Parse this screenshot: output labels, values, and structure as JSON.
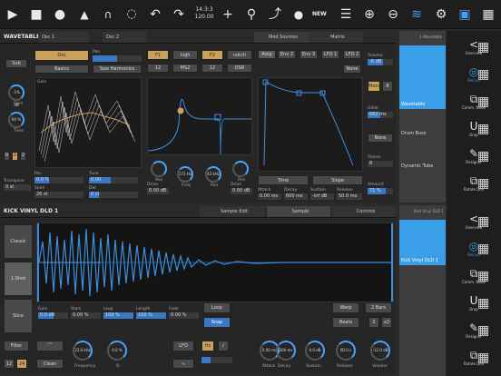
{
  "toolbar": {
    "time_top": "14:3:3",
    "time_bottom": "120.00",
    "new_label": "NEW"
  },
  "device1": {
    "title": "WAVETABLE",
    "tabs": [
      "Osc 1",
      "Osc 2",
      "Mod Sources",
      "Matrix"
    ],
    "chain_label": "1-Wavetable",
    "sub_label": "Sub",
    "osc_btn": "Osc",
    "basics_btn": "Basics",
    "harmonics_btn": "Saw Harmonics",
    "pan_label": "Pan",
    "filter1": "F1",
    "filter1_type": "high",
    "filter2": "F2",
    "filter2_type": "notch",
    "f1_slope": "12",
    "f1_circuit": "MS2",
    "f2_slope": "12",
    "f2_circuit": "OSR",
    "env_tabs": [
      "Amp",
      "Env 2",
      "Env 3",
      "LFO 1",
      "LFO 2"
    ],
    "none_label": "None",
    "knobs": [
      {
        "label": "Gain",
        "value": "-1% dB"
      },
      {
        "label": "Time",
        "value": "60 %"
      },
      {
        "label": "Res",
        "value": ""
      },
      {
        "label": "Freq",
        "value": "172 Hz"
      },
      {
        "label": "Res",
        "value": "43 kHz"
      },
      {
        "label": "Res",
        "value": ""
      }
    ],
    "voice_btns": [
      "0",
      "2",
      "2"
    ],
    "transpose": {
      "label": "Transpose",
      "value": "0 st"
    },
    "pos": {
      "label": "Pos",
      "value": "0.0 %"
    },
    "tune": {
      "label": "Tune",
      "value": "0.00"
    },
    "semi": {
      "label": "Semi",
      "value": "26 st"
    },
    "det": {
      "label": "Det",
      "value": "0 ct"
    },
    "drive1": {
      "label": "Drive",
      "value": "0.00 dB"
    },
    "drive2": {
      "label": "Drive",
      "value": "0.00 dB"
    },
    "time_btn": "Time",
    "slope_btn": "Slope",
    "adsr": [
      {
        "label": "Attack",
        "value": "0.00 ms"
      },
      {
        "label": "Decay",
        "value": "600 ms"
      },
      {
        "label": "Sustain",
        "value": "-inf dB"
      },
      {
        "label": "Release",
        "value": "50.0 ms"
      }
    ],
    "volume": {
      "label": "Volume",
      "value": "-6 dB"
    },
    "mono_label": "Mono",
    "mono_value": "8",
    "glide": {
      "label": "Glide",
      "value": "662 ms"
    },
    "none2": "None",
    "voices": {
      "label": "Voices",
      "value": "8"
    },
    "amount": {
      "label": "Amount",
      "value": "71 %"
    }
  },
  "rack1": {
    "items": [
      "Wavetable",
      "Drum Buss",
      "Dynamic Tube"
    ]
  },
  "device2": {
    "title": "KICK VINYL DLD 1",
    "tabs": [
      "Sample Edit",
      "Sample",
      "Controls"
    ],
    "chain_label": "Kick Vinyl DLD 1",
    "modes": [
      "Classic",
      "1-Shot",
      "Slice"
    ],
    "params": [
      {
        "label": "Gain",
        "value": "0.0 dB"
      },
      {
        "label": "Start",
        "value": "0.00 %"
      },
      {
        "label": "Loop",
        "value": "100 %"
      },
      {
        "label": "Length",
        "value": "100 %"
      },
      {
        "label": "Fade",
        "value": "0.00 %"
      }
    ],
    "loop_btn": "Loop",
    "snap_btn": "Snap",
    "warp_btn": "Warp",
    "bars_btn": "2 Bars",
    "beats_label": "Beats",
    "x2": "x2",
    "div2": "2",
    "filter_btn": "Filter",
    "mode12": "12",
    "mode24": "24",
    "clean": "Clean",
    "freq": {
      "label": "Frequency",
      "value": "22.0 kHz"
    },
    "q": {
      "label": "Q",
      "value": "0.0 %"
    },
    "lfo": "LFO",
    "hz": "Hz",
    "bottom_knobs": [
      {
        "label": "Attack",
        "value": "0.00 ms"
      },
      {
        "label": "Decay",
        "value": "300 ms"
      },
      {
        "label": "Sustain",
        "value": "0.0 dB"
      },
      {
        "label": "Release",
        "value": "60.0 s"
      },
      {
        "label": "Volume",
        "value": "-12.0 dB"
      }
    ]
  },
  "rack2": {
    "items": [
      "Kick Vinyl DLD 1"
    ]
  },
  "icons": [
    {
      "label": "Overview",
      "icon": "<"
    },
    {
      "label": "Record",
      "icon": "◎"
    },
    {
      "label": "Comm. Node",
      "icon": "⧉"
    },
    {
      "label": "Drop",
      "icon": "U"
    },
    {
      "label": "Designer",
      "icon": "✎"
    },
    {
      "label": "Rotate Dev",
      "icon": "⧉"
    },
    {
      "label": "Overview",
      "icon": "<"
    },
    {
      "label": "Record",
      "icon": "◎"
    },
    {
      "label": "Comm. Node",
      "icon": "⧉"
    },
    {
      "label": "Drop",
      "icon": "U"
    },
    {
      "label": "Designer",
      "icon": "✎"
    },
    {
      "label": "Rotate Dev",
      "icon": "⧉"
    }
  ],
  "colors": {
    "accent": "#3a78c4",
    "gold": "#c9a15b",
    "wave": "#3b8fe0"
  }
}
